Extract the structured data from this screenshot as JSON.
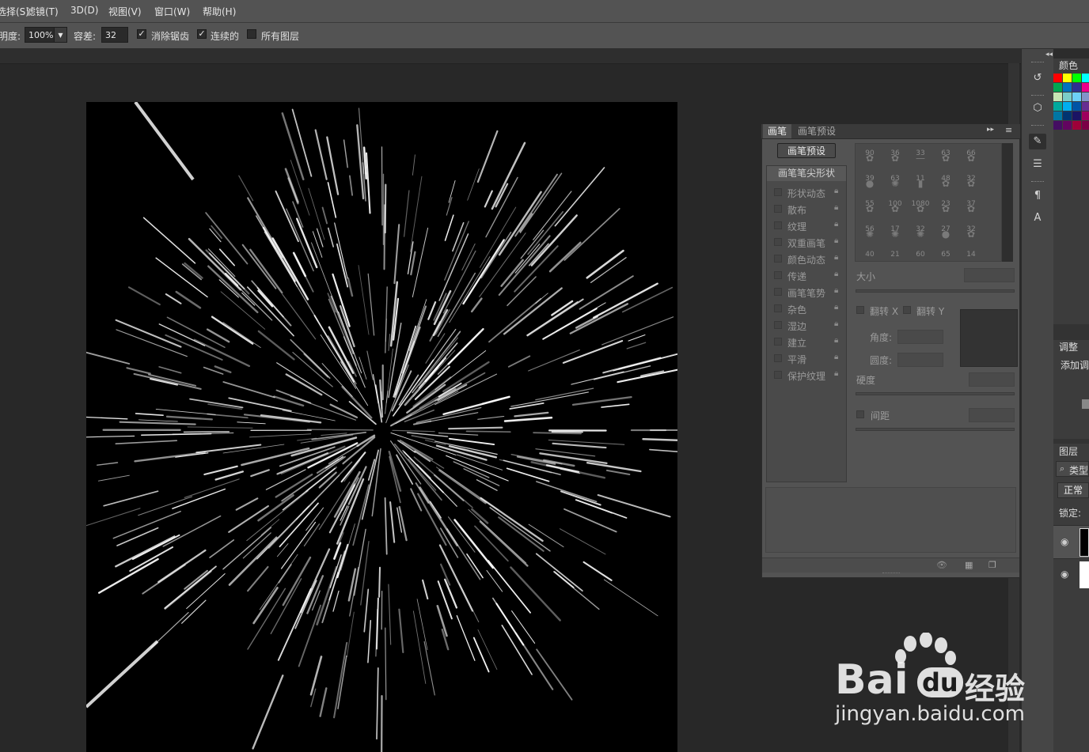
{
  "menu": {
    "items": [
      "选择(S)",
      "滤镜(T)",
      "3D(D)",
      "视图(V)",
      "窗口(W)",
      "帮助(H)"
    ]
  },
  "options": {
    "opacity_label": "明度:",
    "opacity_value": "100%",
    "tolerance_label": "容差:",
    "tolerance_value": "32",
    "antialias_label": "消除锯齿",
    "contiguous_label": "连续的",
    "alllayers_label": "所有图层"
  },
  "brush_panel": {
    "tab_brush": "画笔",
    "tab_presets": "画笔预设",
    "preset_button": "画笔预设",
    "list_header": "画笔笔尖形状",
    "items": [
      "形状动态",
      "散布",
      "纹理",
      "双重画笔",
      "颜色动态",
      "传递",
      "画笔笔势",
      "杂色",
      "湿边",
      "建立",
      "平滑",
      "保护纹理"
    ],
    "tip_sizes": [
      "90",
      "36",
      "33",
      "63",
      "66",
      "39",
      "63",
      "11",
      "48",
      "32",
      "55",
      "100",
      "1080",
      "23",
      "37",
      "56",
      "17",
      "32",
      "27",
      "32",
      "40",
      "21",
      "60",
      "65",
      "14"
    ],
    "size_label": "大小",
    "flipx_label": "翻转 X",
    "flipy_label": "翻转 Y",
    "angle_label": "角度:",
    "roundness_label": "圆度:",
    "hardness_label": "硬度",
    "spacing_label": "间距"
  },
  "right_panels": {
    "color_tab": "颜色",
    "adjust_tab": "调整",
    "adjust_add": "添加调",
    "layers_tab": "图层",
    "filter_kind": "类型",
    "blend_mode": "正常",
    "lock_label": "锁定:"
  },
  "swatches": [
    "#ff0000",
    "#ffff00",
    "#00ff00",
    "#00ffff",
    "#00a651",
    "#0072bc",
    "#2e3192",
    "#ec008c",
    "#c7e6b4",
    "#7bcdc8",
    "#6dcff6",
    "#8393ca",
    "#00a99d",
    "#00aeef",
    "#0054a6",
    "#662d91",
    "#0076a3",
    "#003471",
    "#1b1464",
    "#9e005d",
    "#440e62",
    "#630460",
    "#9e0039",
    "#7b0046"
  ],
  "watermark": {
    "brand_text": "Bai",
    "brand_du": "du",
    "brand_cn": "经验",
    "url": "jingyan.baidu.com"
  }
}
